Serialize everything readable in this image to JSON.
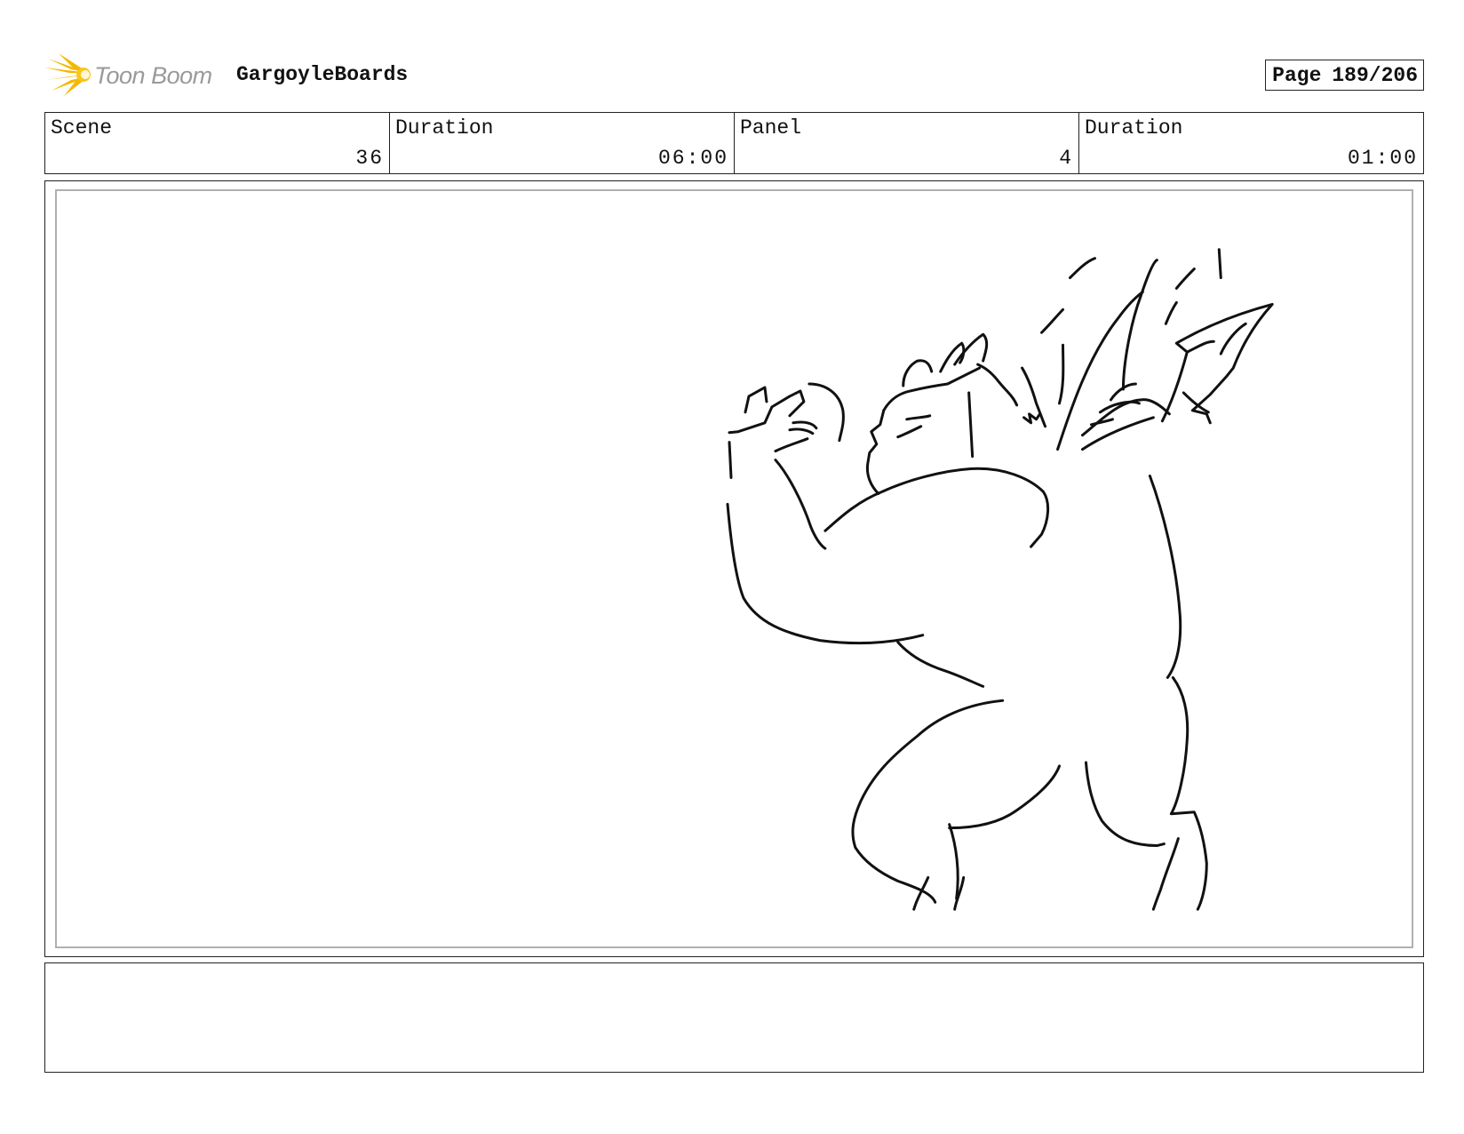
{
  "header": {
    "logo_text": "Toon Boom",
    "project_title": "GargoyleBoards",
    "page_label": "Page",
    "page_number": "189/206"
  },
  "info": {
    "scene_label": "Scene",
    "scene_value": "36",
    "scene_duration_label": "Duration",
    "scene_duration_value": "06:00",
    "panel_label": "Panel",
    "panel_value": "4",
    "panel_duration_label": "Duration",
    "panel_duration_value": "01:00"
  },
  "panel": {
    "drawing": "gargoyle-sketch"
  },
  "notes": {
    "text": ""
  },
  "colors": {
    "logo_burst": "#f5b800",
    "logo_text": "#9a9a9a",
    "frame": "#222222",
    "inner_frame": "#b0b0b0",
    "ink": "#111111"
  }
}
